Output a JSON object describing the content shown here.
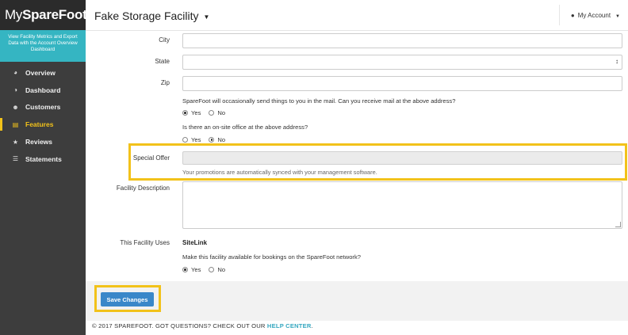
{
  "brand": {
    "prefix": "My",
    "name": "SpareFoot"
  },
  "promo": {
    "text": "View Facility Metrics and Export Data with the Account Overview Dashboard"
  },
  "nav": {
    "items": [
      {
        "label": "Overview",
        "icon": "globe-icon",
        "glyph": "◕"
      },
      {
        "label": "Dashboard",
        "icon": "dashboard-icon",
        "glyph": "◑"
      },
      {
        "label": "Customers",
        "icon": "users-icon",
        "glyph": "☻"
      },
      {
        "label": "Features",
        "icon": "features-icon",
        "glyph": "▤"
      },
      {
        "label": "Reviews",
        "icon": "star-icon",
        "glyph": "★"
      },
      {
        "label": "Statements",
        "icon": "list-icon",
        "glyph": "☰"
      }
    ],
    "active": "Features"
  },
  "header": {
    "facility": "Fake Storage Facility",
    "account": "My Account"
  },
  "form": {
    "city_label": "City",
    "state_label": "State",
    "zip_label": "Zip",
    "mail_question": "SpareFoot will occasionally send things to you in the mail. Can you receive mail at the above address?",
    "mail_yes": "Yes",
    "mail_no": "No",
    "mail_selected": "Yes",
    "office_question": "Is there an on-site office at the above address?",
    "office_yes": "Yes",
    "office_no": "No",
    "office_selected": "No",
    "special_offer_label": "Special Offer",
    "special_offer_help": "Your promotions are automatically synced with your management software.",
    "description_label": "Facility Description",
    "uses_label": "This Facility Uses",
    "uses_value": "SiteLink",
    "bookings_question": "Make this facility available for bookings on the SpareFoot network?",
    "bookings_yes": "Yes",
    "bookings_no": "No",
    "bookings_selected": "Yes",
    "save_label": "Save Changes"
  },
  "footer": {
    "text": "© 2017 SPAREFOOT. GOT QUESTIONS? CHECK OUT OUR ",
    "link": "HELP CENTER",
    "end": "."
  },
  "colors": {
    "sidebar": "#3d3d3d",
    "accent": "#35b5c2",
    "highlight": "#f2c21a",
    "button": "#3a87c9"
  }
}
